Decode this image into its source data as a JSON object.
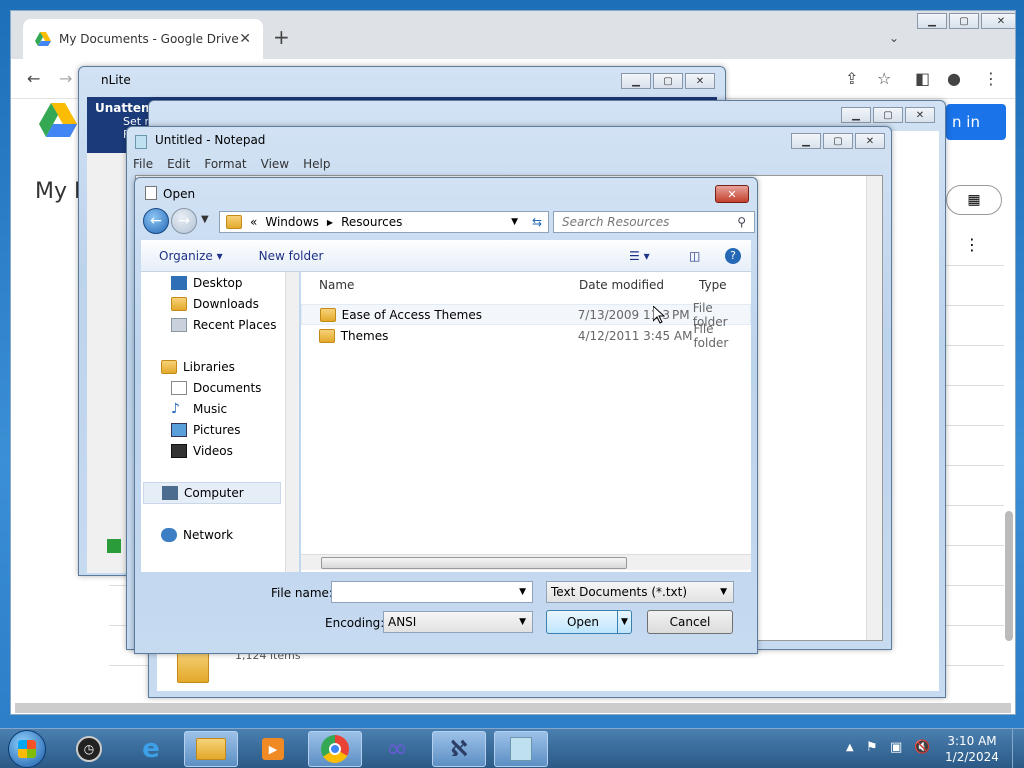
{
  "browser": {
    "tab_title": "My Documents - Google Drive",
    "sign_in": "n in",
    "heading": "My D"
  },
  "nlite": {
    "title": "nLite",
    "panel_title": "Unattend",
    "panel_sub1": "Set n",
    "panel_sub2": "F"
  },
  "notepad": {
    "title": "Untitled - Notepad",
    "menu": [
      "File",
      "Edit",
      "Format",
      "View",
      "Help"
    ]
  },
  "open_dialog": {
    "title": "Open",
    "breadcrumb": [
      "«",
      "Windows",
      "Resources"
    ],
    "search_placeholder": "Search Resources",
    "organize": "Organize",
    "new_folder": "New folder",
    "nav": {
      "favorites": [
        "Desktop",
        "Downloads",
        "Recent Places"
      ],
      "libraries_label": "Libraries",
      "libraries": [
        "Documents",
        "Music",
        "Pictures",
        "Videos"
      ],
      "computer": "Computer",
      "network": "Network"
    },
    "columns": {
      "name": "Name",
      "date": "Date modified",
      "type": "Type"
    },
    "files": [
      {
        "name": "Ease of Access Themes",
        "date": "7/13/2009 11:3 PM",
        "type": "File folder"
      },
      {
        "name": "Themes",
        "date": "4/12/2011 3:45 AM",
        "type": "File folder"
      }
    ],
    "file_name_label": "File name:",
    "file_name_value": "",
    "file_type": "Text Documents (*.txt)",
    "encoding_label": "Encoding:",
    "encoding_value": "ANSI",
    "open_button": "Open",
    "cancel_button": "Cancel"
  },
  "drive_bg": {
    "items_count": "1,124 items"
  },
  "taskbar": {
    "time": "3:10 AM",
    "date": "1/2/2024"
  },
  "colors": {
    "accent": "#1a73e8",
    "taskbar": "#2b5a86"
  }
}
